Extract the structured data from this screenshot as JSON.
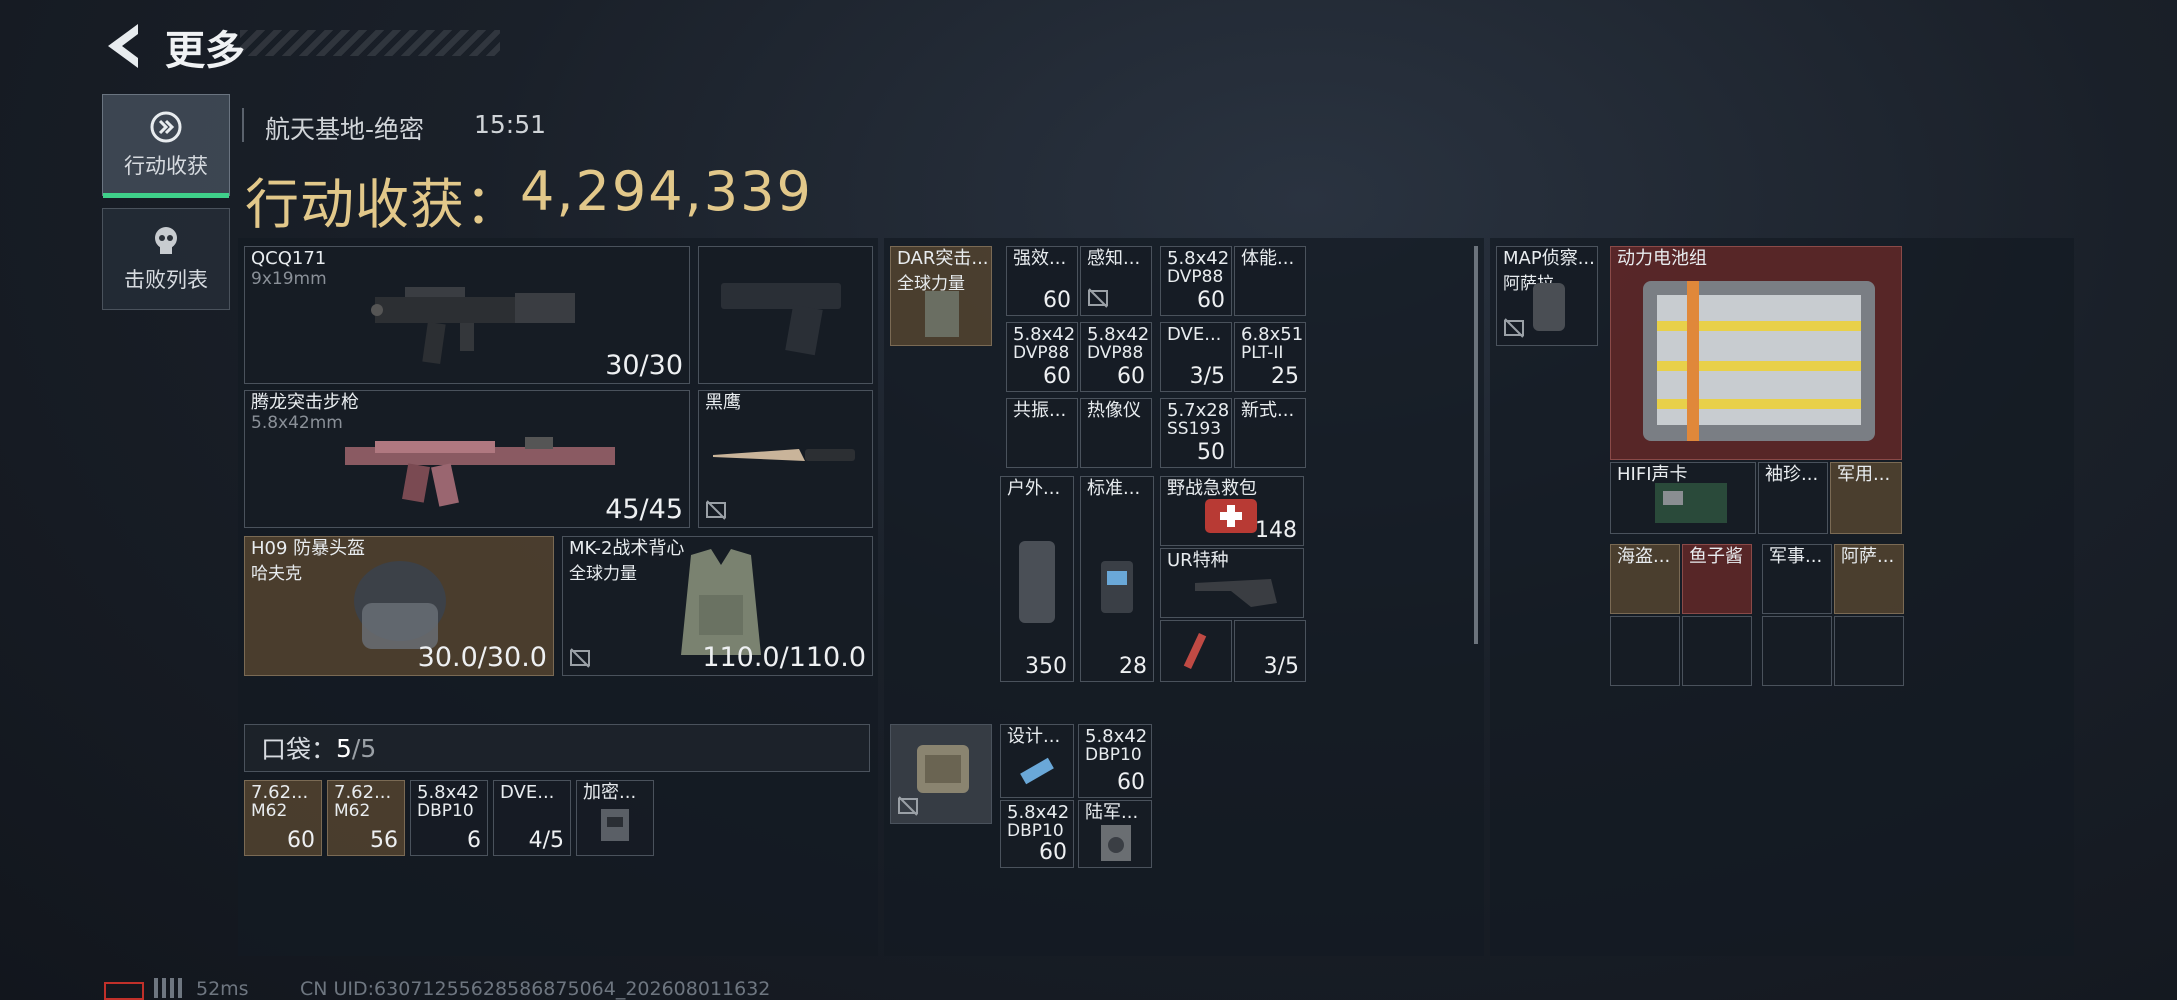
{
  "header": {
    "title": "更多"
  },
  "sidebar": {
    "tabs": [
      {
        "label": "行动收获",
        "icon": "loot-icon",
        "active": true
      },
      {
        "label": "击败列表",
        "icon": "skull-icon",
        "active": false
      }
    ]
  },
  "match": {
    "map": "航天基地-绝密",
    "time": "15:51"
  },
  "gain": {
    "label": "行动收获：",
    "value": "4,294,339"
  },
  "equipment": {
    "primary": {
      "name": "QCQ171",
      "caliber": "9x19mm",
      "ammo": "30/30"
    },
    "secondary": {
      "name": "腾龙突击步枪",
      "caliber": "5.8x42mm",
      "ammo": "45/45"
    },
    "knife": {
      "name": "黑鹰"
    },
    "helmet": {
      "name": "H09 防暴头盔",
      "maker": "哈夫克",
      "durability": "30.0/30.0"
    },
    "vest": {
      "name": "MK-2战术背心",
      "maker": "全球力量",
      "durability": "110.0/110.0"
    }
  },
  "pockets": {
    "label": "口袋：",
    "count": "5",
    "capacity": "/5",
    "items": [
      {
        "name": "7.62...",
        "sub": "M62",
        "qty": "60"
      },
      {
        "name": "7.62...",
        "sub": "M62",
        "qty": "56"
      },
      {
        "name": "5.8x42",
        "sub": "DBP10",
        "qty": "6"
      },
      {
        "name": "DVE...",
        "sub": "",
        "qty": "4/5"
      },
      {
        "name": "加密...",
        "sub": "",
        "qty": ""
      }
    ]
  },
  "chest_rig": {
    "name": "DAR突击...",
    "maker": "全球力量",
    "items": [
      {
        "name": "强效...",
        "qty": "60"
      },
      {
        "name": "感知...",
        "qty": ""
      },
      {
        "name": "5.8x42",
        "sub": "DVP88",
        "qty": "60"
      },
      {
        "name": "体能...",
        "qty": ""
      },
      {
        "name": "5.8x42",
        "sub": "DVP88",
        "qty": "60"
      },
      {
        "name": "5.8x42",
        "sub": "DVP88",
        "qty": "60"
      },
      {
        "name": "DVE...",
        "qty": "3/5"
      },
      {
        "name": "6.8x51",
        "sub": "PLT-II",
        "qty": "25"
      },
      {
        "name": "共振...",
        "qty": ""
      },
      {
        "name": "热像仪",
        "qty": ""
      },
      {
        "name": "5.7x28",
        "sub": "SS193",
        "qty": "50"
      },
      {
        "name": "新式...",
        "qty": ""
      },
      {
        "name": "户外...",
        "qty": "350"
      },
      {
        "name": "标准...",
        "qty": "28"
      },
      {
        "name": "野战急救包",
        "qty": "148"
      },
      {
        "name": "UR特种",
        "qty": ""
      },
      {
        "name": "",
        "qty": ""
      },
      {
        "name": "",
        "qty": "3/5"
      }
    ]
  },
  "safebox": {
    "items": [
      {
        "name": "设计...",
        "qty": ""
      },
      {
        "name": "5.8x42",
        "sub": "DBP10",
        "qty": "60"
      },
      {
        "name": "5.8x42",
        "sub": "DBP10",
        "qty": "60"
      },
      {
        "name": "陆军...",
        "qty": ""
      }
    ]
  },
  "backpack": {
    "name": "MAP侦察...",
    "maker": "阿萨拉",
    "items": [
      {
        "name": "动力电池组"
      },
      {
        "name": "HIFI声卡"
      },
      {
        "name": "袖珍..."
      },
      {
        "name": "军用..."
      },
      {
        "name": "海盗..."
      },
      {
        "name": "鱼子酱"
      },
      {
        "name": "军事..."
      },
      {
        "name": "阿萨..."
      },
      {
        "name": ""
      },
      {
        "name": ""
      },
      {
        "name": ""
      },
      {
        "name": ""
      }
    ]
  },
  "status": {
    "ping": "52ms",
    "uid": "CN UID:630712556285868750​64_202608011632"
  },
  "colors": {
    "accent_gold": "#e2c88a",
    "active_tab": "#3fd08a",
    "rare_brown": "#5c4a32",
    "rare_red": "#6e2a28"
  }
}
